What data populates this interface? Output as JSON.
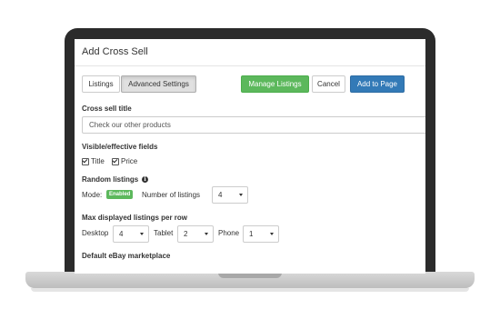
{
  "dialog": {
    "title": "Add Cross Sell"
  },
  "toolbar": {
    "tabs": [
      {
        "label": "Listings",
        "active": false
      },
      {
        "label": "Advanced Settings",
        "active": true
      }
    ],
    "manage_label": "Manage Listings",
    "cancel_label": "Cancel",
    "add_label": "Add to Page"
  },
  "cross_sell_title": {
    "label": "Cross sell title",
    "value": "Check our other products"
  },
  "visible_fields": {
    "label": "Visible/effective fields",
    "options": [
      {
        "label": "Title",
        "checked": true
      },
      {
        "label": "Price",
        "checked": true
      }
    ]
  },
  "random_listings": {
    "label": "Random listings",
    "info_icon": "i",
    "mode_label": "Mode:",
    "mode_badge": "Enabled",
    "count_label": "Number of listings",
    "count_value": "4"
  },
  "max_per_row": {
    "label": "Max displayed listings per row",
    "devices": [
      {
        "label": "Desktop",
        "value": "4"
      },
      {
        "label": "Tablet",
        "value": "2"
      },
      {
        "label": "Phone",
        "value": "1"
      }
    ]
  },
  "marketplace": {
    "label": "Default eBay marketplace"
  },
  "colors": {
    "success": "#5cb85c",
    "primary": "#337ab7",
    "laptop_bezel": "#2b2b2b"
  }
}
